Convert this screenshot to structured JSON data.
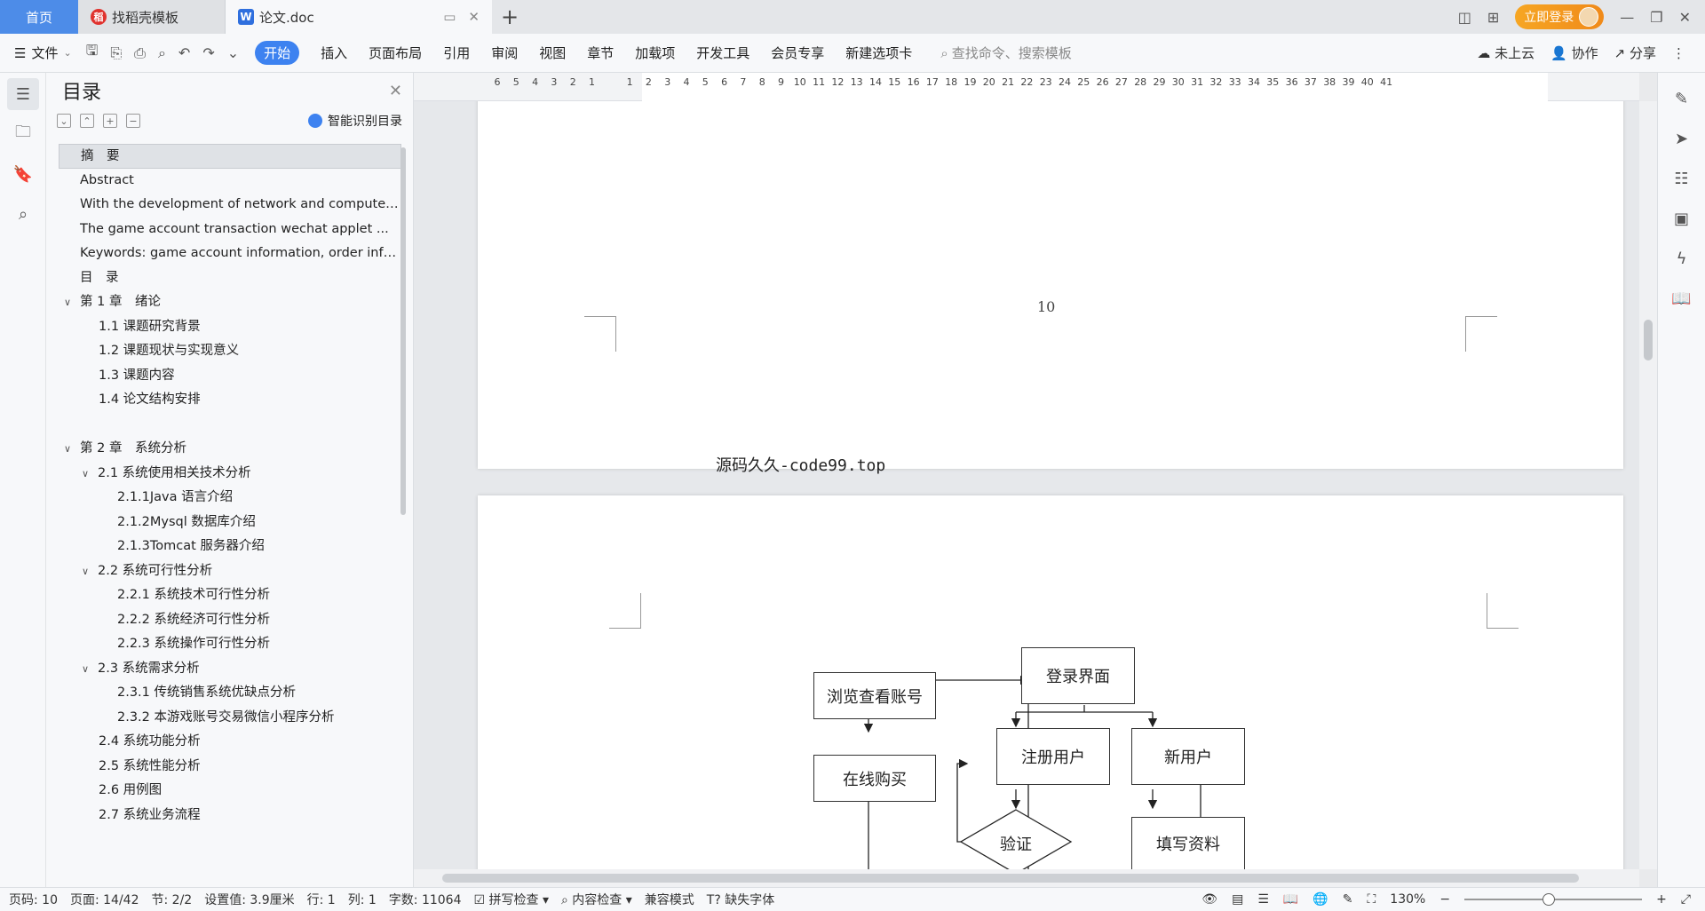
{
  "tabs": [
    {
      "label": "首页"
    },
    {
      "label": "找稻壳模板"
    },
    {
      "label": "论文.doc"
    }
  ],
  "title_bar": {
    "login_label": "立即登录"
  },
  "ribbon": {
    "file_label": "文件",
    "items": [
      "开始",
      "插入",
      "页面布局",
      "引用",
      "审阅",
      "视图",
      "章节",
      "加载项",
      "开发工具",
      "会员专享",
      "新建选项卡"
    ],
    "search_placeholder": "查找命令、搜索模板",
    "right": {
      "cloud": "未上云",
      "collab": "协作",
      "share": "分享"
    }
  },
  "toc": {
    "title": "目录",
    "smart_label": "智能识别目录",
    "items": [
      {
        "text": "摘　要",
        "level": 0
      },
      {
        "text": "Abstract",
        "level": 0
      },
      {
        "text": "With the development of network and computer technology...",
        "level": 0
      },
      {
        "text": "The game account transaction wechat applet ...",
        "level": 0
      },
      {
        "text": "Keywords: game account information, order information...",
        "level": 0
      },
      {
        "text": "目　录",
        "level": 0
      },
      {
        "text": "第 1 章　绪论",
        "level": 0
      },
      {
        "text": "1.1 课题研究背景",
        "level": 1
      },
      {
        "text": "1.2 课题现状与实现意义",
        "level": 1
      },
      {
        "text": "1.3 课题内容",
        "level": 1
      },
      {
        "text": "1.4 论文结构安排",
        "level": 1
      },
      {
        "text": "第 2 章　系统分析",
        "level": 0
      },
      {
        "text": "2.1 系统使用相关技术分析",
        "level": 1
      },
      {
        "text": "2.1.1Java 语言介绍",
        "level": 2
      },
      {
        "text": "2.1.2Mysql 数据库介绍",
        "level": 2
      },
      {
        "text": "2.1.3Tomcat 服务器介绍",
        "level": 2
      },
      {
        "text": "2.2 系统可行性分析",
        "level": 1
      },
      {
        "text": "2.2.1 系统技术可行性分析",
        "level": 2
      },
      {
        "text": "2.2.2 系统经济可行性分析",
        "level": 2
      },
      {
        "text": "2.2.3 系统操作可行性分析",
        "level": 2
      },
      {
        "text": "2.3 系统需求分析",
        "level": 1
      },
      {
        "text": "2.3.1 传统销售系统优缺点分析",
        "level": 2
      },
      {
        "text": "2.3.2 本游戏账号交易微信小程序分析",
        "level": 2
      },
      {
        "text": "2.4 系统功能分析",
        "level": 1
      },
      {
        "text": "2.5 系统性能分析",
        "level": 1
      },
      {
        "text": "2.6 用例图",
        "level": 1
      },
      {
        "text": "2.7 系统业务流程",
        "level": 1
      }
    ]
  },
  "ruler_ticks": [
    "6",
    "5",
    "4",
    "3",
    "2",
    "1",
    "",
    "1",
    "2",
    "3",
    "4",
    "5",
    "6",
    "7",
    "8",
    "9",
    "10",
    "11",
    "12",
    "13",
    "14",
    "15",
    "16",
    "17",
    "18",
    "19",
    "20",
    "21",
    "22",
    "23",
    "24",
    "25",
    "26",
    "27",
    "28",
    "29",
    "30",
    "31",
    "32",
    "33",
    "34",
    "35",
    "36",
    "37",
    "38",
    "39",
    "40",
    "41"
  ],
  "document": {
    "page_number": "10",
    "watermark": "源码久久-code99.top",
    "flowchart": {
      "login": "登录界面",
      "browse": "浏览查看账号",
      "register": "注册用户",
      "new_user": "新用户",
      "buy": "在线购买",
      "verify": "验证",
      "fill": "填写资料"
    }
  },
  "status": {
    "page": "页码: 10",
    "pages": "页面: 14/42",
    "section": "节: 2/2",
    "setting": "设置值: 3.9厘米",
    "row": "行: 1",
    "col": "列: 1",
    "words": "字数: 11064",
    "spell": "拼写检查",
    "content_check": "内容检查",
    "compat": "兼容模式",
    "missing_font": "缺失字体",
    "zoom": "130%"
  }
}
